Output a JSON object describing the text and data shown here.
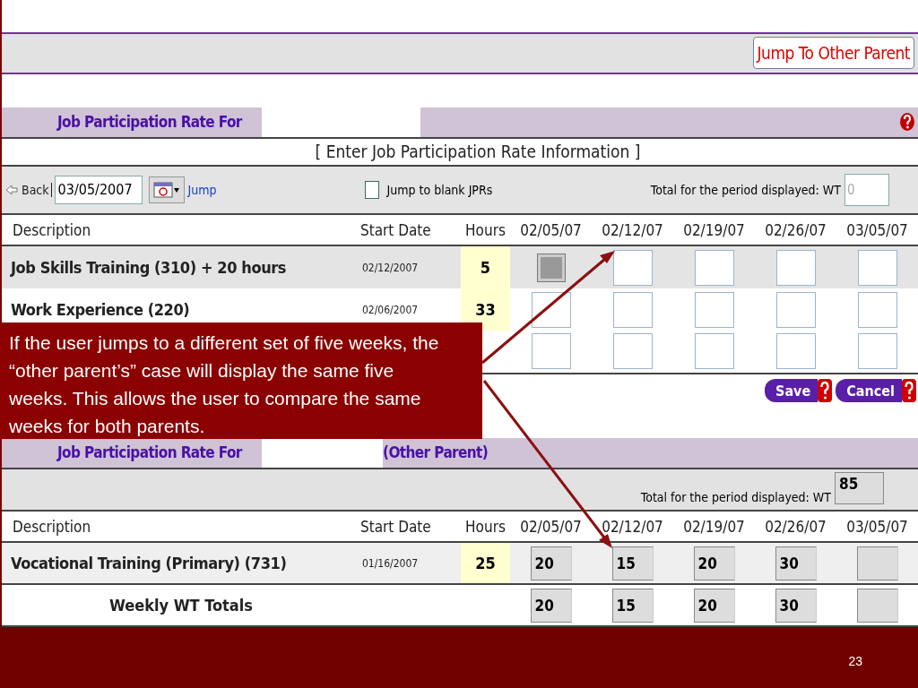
{
  "header": {
    "jump_button": "Jump To Other Parent"
  },
  "section": {
    "title": "Job Participation Rate For",
    "subtitle": "[ Enter Job Participation Rate Information ]"
  },
  "toolbar": {
    "back": "Back",
    "date": "03/05/2007",
    "jump": "Jump",
    "blank_checkbox": {
      "label": "Jump to blank JPRs",
      "checked": false
    },
    "total_label": "Total for the period displayed: WT",
    "total_value": "0"
  },
  "table": {
    "columns": [
      "Description",
      "Start Date",
      "Hours",
      "02/05/07",
      "02/12/07",
      "02/19/07",
      "02/26/07",
      "03/05/07"
    ],
    "rows": [
      {
        "description": "Job Skills Training (310) + 20 hours",
        "start_date": "02/12/2007",
        "hours": "5",
        "cells": [
          {
            "disabled": true
          },
          {
            "disabled": false
          },
          {
            "disabled": false
          },
          {
            "disabled": false
          },
          {
            "disabled": false
          }
        ]
      },
      {
        "description": "Work Experience (220)",
        "start_date": "02/06/2007",
        "hours": "33",
        "cells": [
          {
            "disabled": false
          },
          {
            "disabled": false
          },
          {
            "disabled": false
          },
          {
            "disabled": false
          },
          {
            "disabled": false
          }
        ]
      },
      {
        "cells": [
          {
            "disabled": false
          },
          {
            "disabled": false
          },
          {
            "disabled": false
          },
          {
            "disabled": false
          },
          {
            "disabled": false
          }
        ]
      }
    ]
  },
  "actions": [
    "Save",
    "Cancel"
  ],
  "other": {
    "title": "Job Participation Rate For",
    "parent": "(Other Parent)",
    "total_label": "Total for the period displayed: WT",
    "total_value": "85",
    "table": {
      "columns": [
        "Description",
        "Start Date",
        "Hours",
        "02/05/07",
        "02/12/07",
        "02/19/07",
        "02/26/07",
        "03/05/07"
      ],
      "rows": [
        {
          "cells": [
            "Vocational Training (Primary) (731)",
            "01/16/2007",
            "25",
            "20",
            "15",
            "20",
            "30",
            null
          ]
        }
      ]
    },
    "totals": {
      "label": "Weekly WT Totals",
      "cells": [
        "20",
        "15",
        "20",
        "30",
        null
      ]
    }
  },
  "callout": "If the user jumps to a different set of five weeks, the “other parent’s” case will display the same five weeks. This allows the user to compare the same weeks for both parents.",
  "slide_number": "23"
}
